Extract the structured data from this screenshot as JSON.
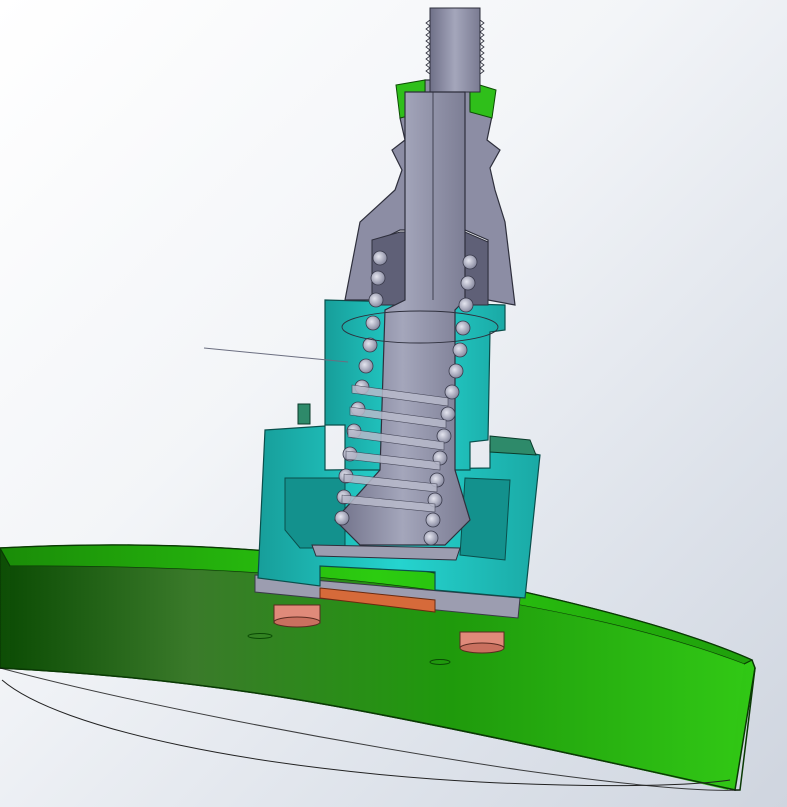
{
  "scene": {
    "subject": "valve-section-view",
    "colors": {
      "background_top": "#ffffff",
      "background_bottom": "#cfd5df",
      "flange_green": "#22b30c",
      "flange_dark": "#0f5c06",
      "body_cyan": "#1fc7c2",
      "stem_gray": "#8d8ea6",
      "spring_gray": "#a9abbe",
      "nut_green": "#2fbf1a",
      "gasket_orange": "#d66a3a",
      "bolt_salmon": "#e08a7a"
    }
  }
}
